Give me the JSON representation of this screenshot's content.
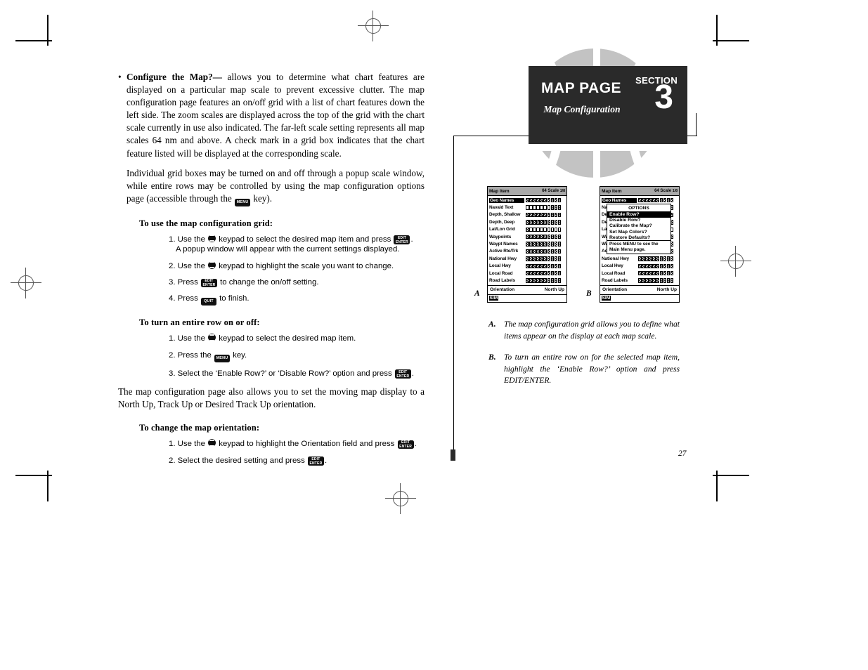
{
  "section_header": {
    "title": "MAP PAGE",
    "subtitle": "Map Configuration",
    "section_word": "SECTION",
    "section_number": "3",
    "bg_color": "#2a2a2a"
  },
  "page_number": "27",
  "body": {
    "bullet_marker": "•",
    "bullet_lead": "Configure the Map?—",
    "bullet_text": " allows you to determine what chart features are displayed on a particular map scale to prevent excessive clutter. The map configuration page features an on/off grid with a list of chart features down the left side. The zoom scales are displayed across the top of the grid with the chart scale currently in use also indicated. The far-left scale setting represents all map scales 64 nm and above. A check mark in a grid box indicates that the chart feature listed will be displayed at the corresponding scale.",
    "para2_before": "Individual grid boxes may be turned on and off through a popup scale window, while entire rows may be controlled by using the map configuration options page (accessible through the ",
    "para2_after": " key).",
    "para3": "The map configuration page also allows you to set the moving map display to a North Up, Track Up or Desired Track Up orientation."
  },
  "keys": {
    "edit_enter_line1": "EDIT",
    "edit_enter_line2": "ENTER",
    "quit": "QUIT",
    "menu": "MENU"
  },
  "procedures": [
    {
      "heading": "To use the map configuration grid:",
      "steps": [
        {
          "num": "1.",
          "pre": "Use the ",
          "mid": " keypad to select the desired map item and press ",
          "key": "edit_enter",
          "post": ".",
          "cont": "A popup window will appear with the current settings displayed."
        },
        {
          "num": "2.",
          "pre": "Use the ",
          "mid": " keypad to highlight the scale you want to change.",
          "key": "",
          "post": ""
        },
        {
          "num": "3.",
          "pre": "Press ",
          "key": "edit_enter",
          "post": " to change the on/off setting."
        },
        {
          "num": "4.",
          "pre": "Press ",
          "key": "quit",
          "post": " to finish."
        }
      ]
    },
    {
      "heading": "To turn an entire row on or off:",
      "steps": [
        {
          "num": "1.",
          "pre": "Use the ",
          "mid": " keypad to select the desired map item.",
          "key": "",
          "post": ""
        },
        {
          "num": "2.",
          "pre": "Press the ",
          "key": "menu",
          "post": " key."
        },
        {
          "num": "3.",
          "pre": "Select the ‘Enable Row?’ or ‘Disable Row?’ option and press ",
          "key": "edit_enter",
          "post": "."
        }
      ]
    },
    {
      "heading": "To change the map orientation:",
      "steps": [
        {
          "num": "1.",
          "pre": "Use the ",
          "mid": " keypad to highlight the Orientation field and press ",
          "key": "edit_enter",
          "post": "."
        },
        {
          "num": "2.",
          "pre": "Select the desired setting and press ",
          "key": "edit_enter",
          "post": "."
        }
      ]
    }
  ],
  "figures": {
    "a_label": "A",
    "b_label": "B",
    "screen": {
      "header_left": "Map Item",
      "header_scale_num": "64",
      "header_scale_word": "Scale",
      "header_scale_frac": "1/8",
      "orientation_label": "Orientation",
      "orientation_value": "North Up",
      "status": "SIM",
      "columns": 10,
      "rows": [
        {
          "label": "Geo Names",
          "selected": true,
          "cells": [
            1,
            1,
            1,
            1,
            1,
            1,
            1,
            1,
            1,
            1
          ]
        },
        {
          "label": "Navaid Text",
          "selected": false,
          "cells": [
            0,
            0,
            0,
            0,
            0,
            0,
            0,
            1,
            1,
            1
          ]
        },
        {
          "label": "Depth, Shallow",
          "selected": false,
          "cells": [
            1,
            1,
            1,
            1,
            1,
            1,
            1,
            1,
            1,
            1
          ]
        },
        {
          "label": "Depth, Deep",
          "selected": false,
          "cells": [
            1,
            1,
            1,
            1,
            1,
            1,
            1,
            1,
            1,
            1
          ]
        },
        {
          "label": "Lat/Lon Grid",
          "selected": false,
          "cells": [
            1,
            0,
            0,
            0,
            0,
            0,
            0,
            0,
            0,
            0
          ]
        },
        {
          "label": "Waypoints",
          "selected": false,
          "cells": [
            1,
            1,
            1,
            1,
            1,
            1,
            1,
            1,
            1,
            1
          ]
        },
        {
          "label": "Waypt Names",
          "selected": false,
          "cells": [
            1,
            1,
            1,
            1,
            1,
            1,
            1,
            1,
            1,
            1
          ]
        },
        {
          "label": "Active Rte/Trk",
          "selected": false,
          "cells": [
            1,
            1,
            1,
            1,
            1,
            1,
            1,
            1,
            1,
            1
          ]
        },
        {
          "label": "National Hwy",
          "selected": false,
          "cells": [
            1,
            1,
            1,
            1,
            1,
            1,
            1,
            1,
            1,
            1
          ]
        },
        {
          "label": "Local Hwy",
          "selected": false,
          "cells": [
            1,
            1,
            1,
            1,
            1,
            1,
            1,
            1,
            1,
            1
          ]
        },
        {
          "label": "Local Road",
          "selected": false,
          "cells": [
            1,
            1,
            1,
            1,
            1,
            1,
            1,
            1,
            1,
            1
          ]
        },
        {
          "label": "Road Labels",
          "selected": false,
          "cells": [
            1,
            1,
            1,
            1,
            1,
            1,
            1,
            1,
            1,
            1
          ]
        }
      ]
    },
    "options_popup": {
      "title": "OPTIONS",
      "items": [
        {
          "label": "Enable Row?",
          "selected": true
        },
        {
          "label": "Disable Row?",
          "selected": false
        },
        {
          "label": "Calibrate the Map?",
          "selected": false
        },
        {
          "label": "Set Map Colors?",
          "selected": false
        },
        {
          "label": "Restore Defaults?",
          "selected": false
        }
      ],
      "note": "Press MENU to see the Main Menu page."
    }
  },
  "captions": [
    {
      "letter": "A.",
      "text": "The map configuration grid allows you to define what items appear on the display at each map scale."
    },
    {
      "letter": "B.",
      "text": "To turn an entire row on for the selected map item, highlight the ‘Enable Row?’ option and press EDIT/ENTER."
    }
  ]
}
